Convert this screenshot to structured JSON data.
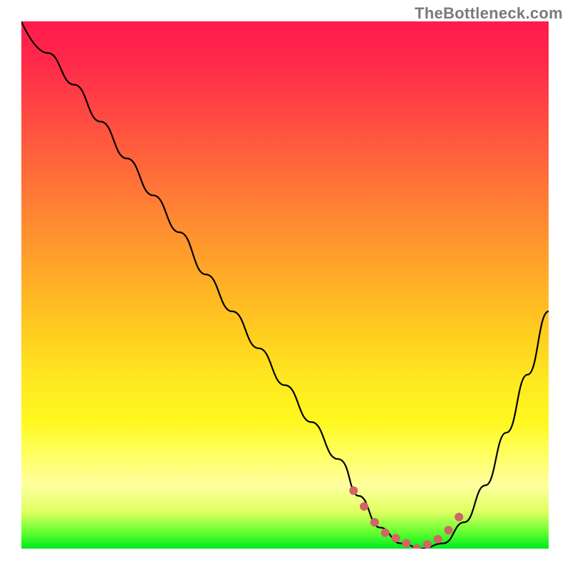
{
  "watermark": "TheBottleneck.com",
  "chart_data": {
    "type": "line",
    "title": "",
    "xlabel": "",
    "ylabel": "",
    "xlim": [
      0,
      100
    ],
    "ylim": [
      0,
      100
    ],
    "series": [
      {
        "name": "bottleneck-curve",
        "x": [
          0,
          5,
          10,
          15,
          20,
          25,
          30,
          35,
          40,
          45,
          50,
          55,
          60,
          64,
          68,
          72,
          76,
          80,
          84,
          88,
          92,
          96,
          100
        ],
        "values": [
          100,
          94,
          88,
          81,
          74,
          67,
          60,
          52,
          45,
          38,
          31,
          24,
          17,
          10,
          4,
          1,
          0,
          1,
          5,
          12,
          22,
          33,
          45
        ]
      }
    ],
    "markers": {
      "name": "highlighted-range",
      "color": "#d16565",
      "x": [
        63,
        65,
        67,
        69,
        71,
        73,
        75,
        77,
        79,
        81,
        83
      ],
      "values": [
        11,
        8,
        5,
        3,
        2,
        1,
        0,
        0.8,
        1.8,
        3.5,
        6
      ]
    },
    "colors": {
      "curve": "#000000",
      "marker": "#d16565"
    }
  }
}
